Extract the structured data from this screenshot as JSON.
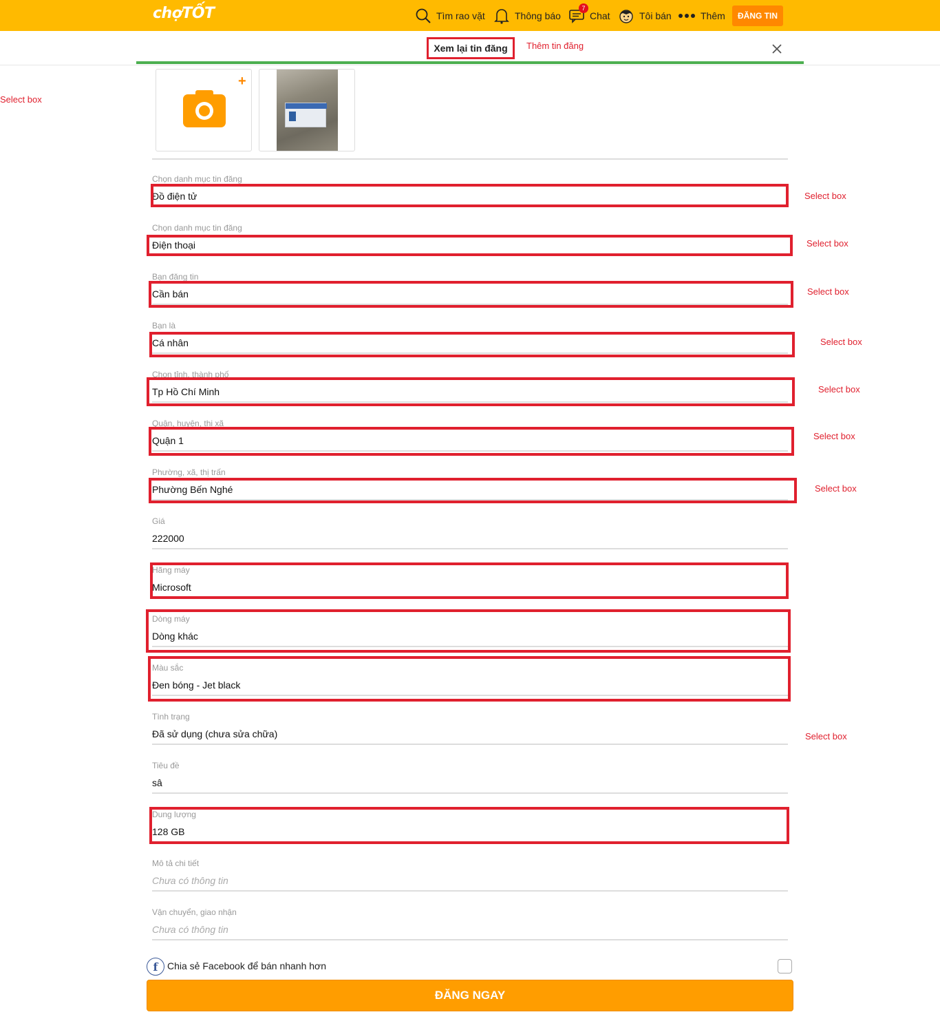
{
  "header": {
    "logo": "chợTỐT",
    "nav": {
      "search": "Tìm rao vặt",
      "notifications": "Thông báo",
      "chat": "Chat",
      "chat_badge": "7",
      "my_ads": "Tôi bán",
      "more": "Thêm"
    },
    "post_button": "ĐĂNG TIN"
  },
  "subheader": {
    "preview_tab": "Xem lại tin đăng",
    "add_tab": "Thêm tin đăng"
  },
  "annotations": {
    "select_box": "Select box",
    "left_note": "Select box"
  },
  "form": {
    "fields": [
      {
        "label": "Chọn danh mục tin đăng",
        "value": "Đồ điện tử"
      },
      {
        "label": "Chọn danh mục tin đăng",
        "value": "Điện thoại"
      },
      {
        "label": "Bạn đăng tin",
        "value": "Cần bán"
      },
      {
        "label": "Bạn là",
        "value": "Cá nhân"
      },
      {
        "label": "Chọn tỉnh, thành phố",
        "value": "Tp Hồ Chí Minh"
      },
      {
        "label": "Quận, huyện, thị xã",
        "value": "Quận 1"
      },
      {
        "label": "Phường, xã, thị trấn",
        "value": "Phường Bến Nghé"
      },
      {
        "label": "Giá",
        "value": "222000"
      },
      {
        "label": "Hãng máy",
        "value": "Microsoft"
      },
      {
        "label": "Dòng máy",
        "value": "Dòng khác"
      },
      {
        "label": "Màu sắc",
        "value": "Đen bóng - Jet black"
      },
      {
        "label": "Tình trạng",
        "value": "Đã sử dụng (chưa sửa chữa)"
      },
      {
        "label": "Tiêu đề",
        "value": "sâ"
      },
      {
        "label": "Dung lượng",
        "value": "128 GB"
      },
      {
        "label": "Mô tả chi tiết",
        "value": "Chưa có thông tin"
      },
      {
        "label": "Vận chuyển, giao nhận",
        "value": "Chưa có thông tin"
      }
    ],
    "facebook_share": "Chia sẻ Facebook để bán nhanh hơn",
    "submit": "ĐĂNG NGAY"
  },
  "colors": {
    "brand": "#ffba00",
    "accent": "#ff8800",
    "annotation": "#e0202e",
    "progress": "#4caf50"
  }
}
